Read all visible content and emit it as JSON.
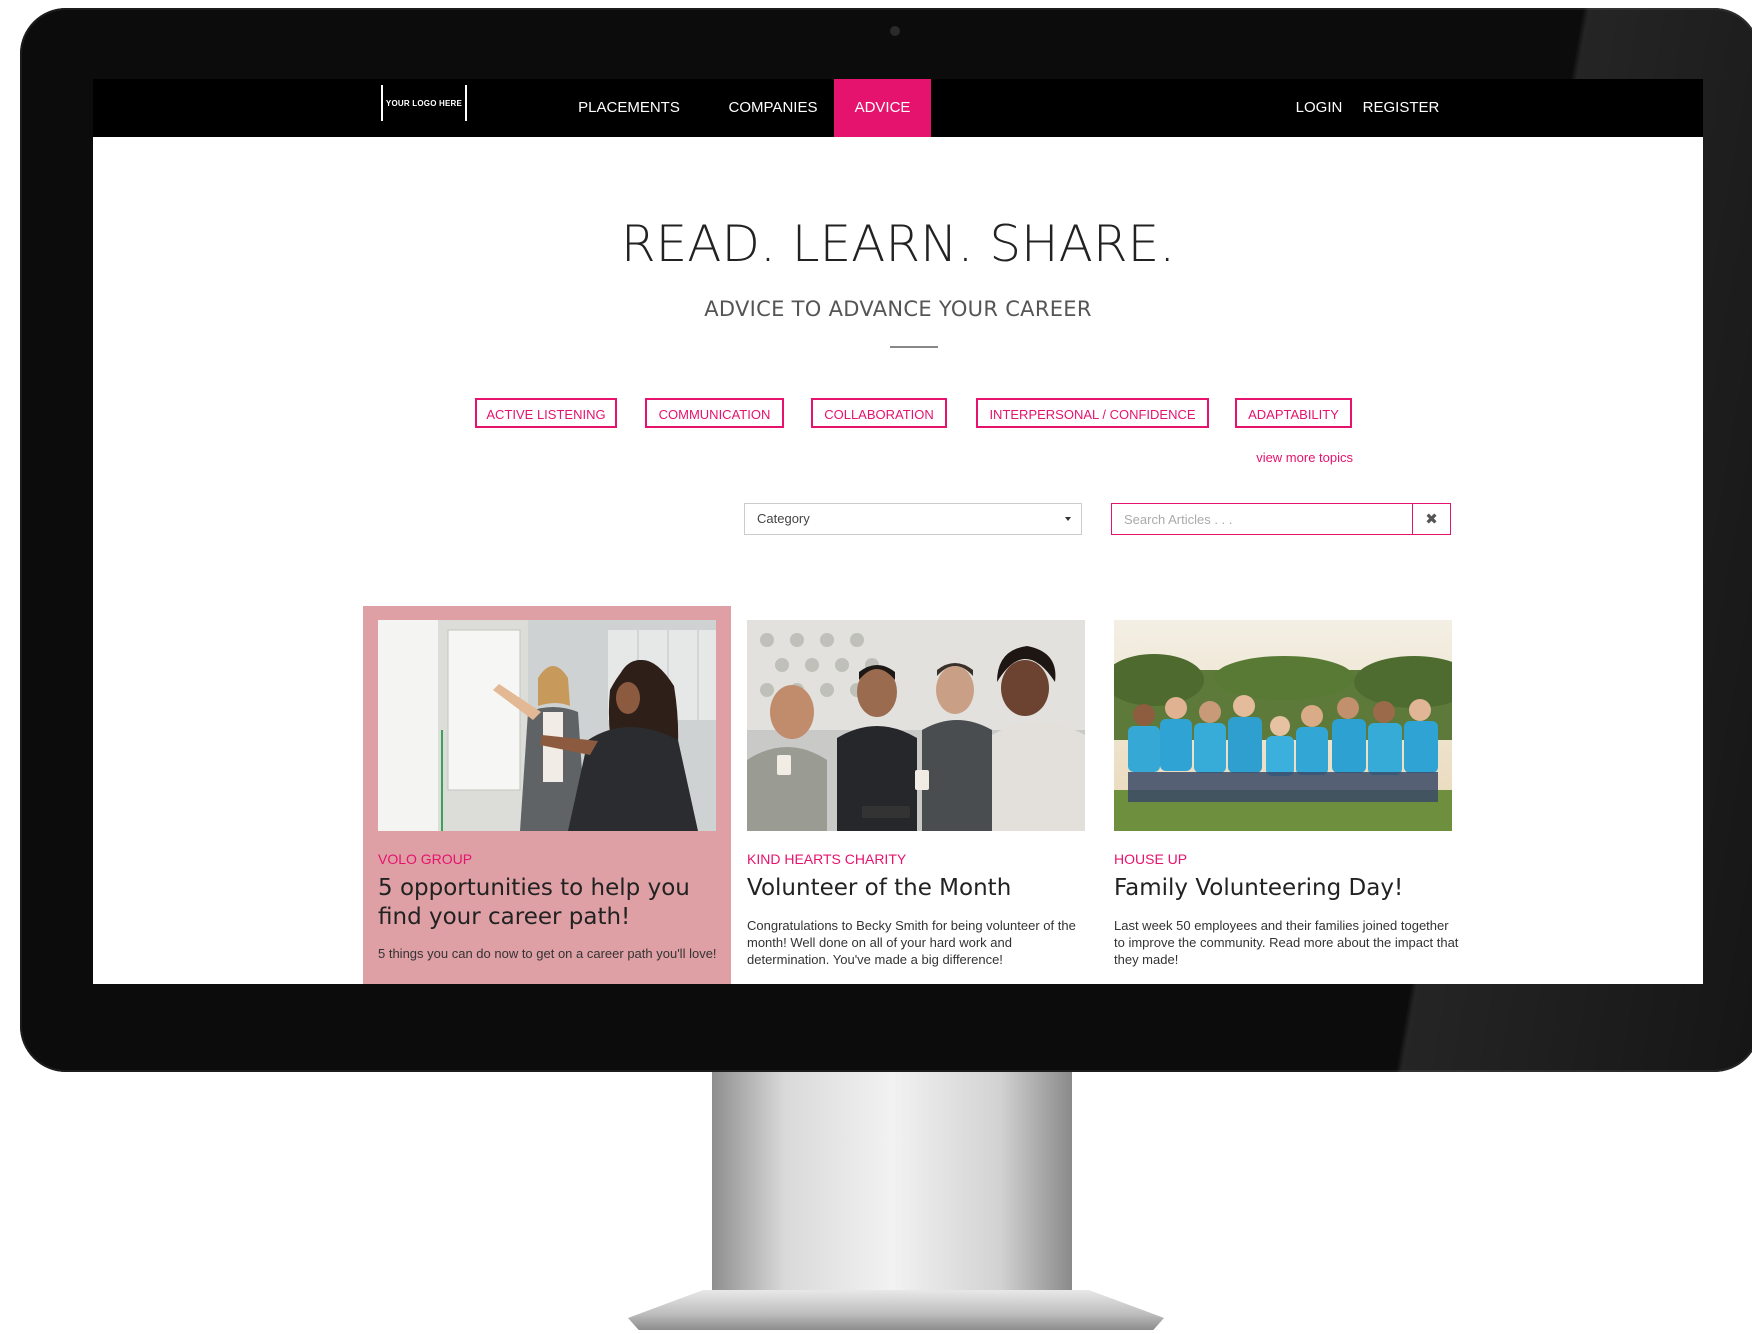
{
  "nav": {
    "logo": "YOUR LOGO HERE",
    "items": [
      {
        "label": "PLACEMENTS"
      },
      {
        "label": "COMPANIES"
      },
      {
        "label": "ADVICE",
        "active": true
      }
    ],
    "login": "LOGIN",
    "register": "REGISTER"
  },
  "hero": {
    "title": "READ. LEARN. SHARE.",
    "subtitle": "ADVICE TO ADVANCE YOUR CAREER"
  },
  "topics": [
    {
      "label": "ACTIVE LISTENING"
    },
    {
      "label": "COMMUNICATION"
    },
    {
      "label": "COLLABORATION"
    },
    {
      "label": "INTERPERSONAL / CONFIDENCE"
    },
    {
      "label": "ADAPTABILITY"
    }
  ],
  "view_more": "view more topics",
  "filters": {
    "category": "Category",
    "search_placeholder": "Search Articles . . .",
    "clear_icon": "close-icon"
  },
  "cards": [
    {
      "company": "VOLO GROUP",
      "title": "5 opportunities to help you find your career path!",
      "excerpt": "5 things you can do now to get on a career path you'll love!",
      "image": "woman-writing-on-whiteboard-photo"
    },
    {
      "company": "KIND HEARTS CHARITY",
      "title": "Volunteer of the Month",
      "excerpt": "Congratulations to Becky Smith for being volunteer of the month! Well done on all of your hard work and determination. You've made a big difference!",
      "image": "group-with-coffee-and-tablet-photo"
    },
    {
      "company": "HOUSE UP",
      "title": "Family Volunteering Day!",
      "excerpt": "Last week 50 employees and their families joined together to improve the community. Read more about the impact that they made!",
      "image": "volunteers-in-blue-shirts-photo"
    }
  ],
  "colors": {
    "accent": "#e6136e",
    "navbar": "#000000",
    "featured_card": "#dea0a5"
  }
}
